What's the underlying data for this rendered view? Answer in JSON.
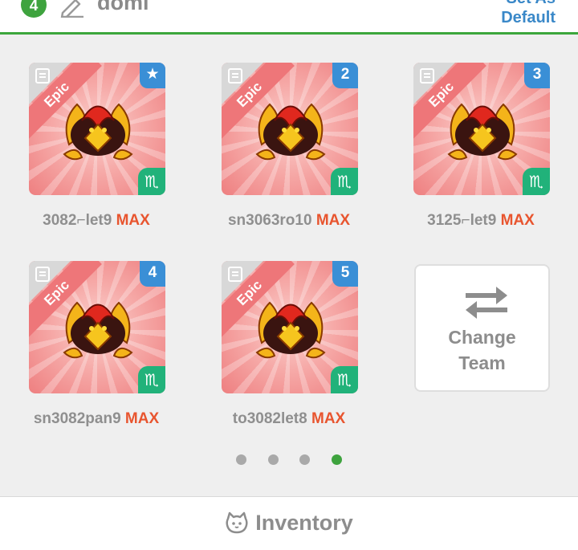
{
  "header": {
    "team_number": "4",
    "team_name": "domi",
    "set_default_label": "Set As\nDefault"
  },
  "cards": [
    {
      "rarity": "Epic",
      "rank_badge": "★",
      "element": "♏",
      "name": "3082",
      "name_suffix": "let9",
      "level": "MAX"
    },
    {
      "rarity": "Epic",
      "rank_badge": "2",
      "element": "♏",
      "name": "sn3063ro10",
      "name_suffix": "",
      "level": "MAX"
    },
    {
      "rarity": "Epic",
      "rank_badge": "3",
      "element": "♏",
      "name": "3125",
      "name_suffix": "let9",
      "level": "MAX"
    },
    {
      "rarity": "Epic",
      "rank_badge": "4",
      "element": "♏",
      "name": "sn3082pan9",
      "name_suffix": "",
      "level": "MAX"
    },
    {
      "rarity": "Epic",
      "rank_badge": "5",
      "element": "♏",
      "name": "to3082let8",
      "name_suffix": "",
      "level": "MAX"
    }
  ],
  "change_team": {
    "line1": "Change",
    "line2": "Team"
  },
  "pagination": {
    "pages": 4,
    "active": 4
  },
  "footer": {
    "label": "Inventory"
  },
  "colors": {
    "accent_green": "#3ea33e",
    "link_blue": "#3a88c8",
    "max_orange": "#e8552f",
    "epic_pink": "#ee7679"
  }
}
